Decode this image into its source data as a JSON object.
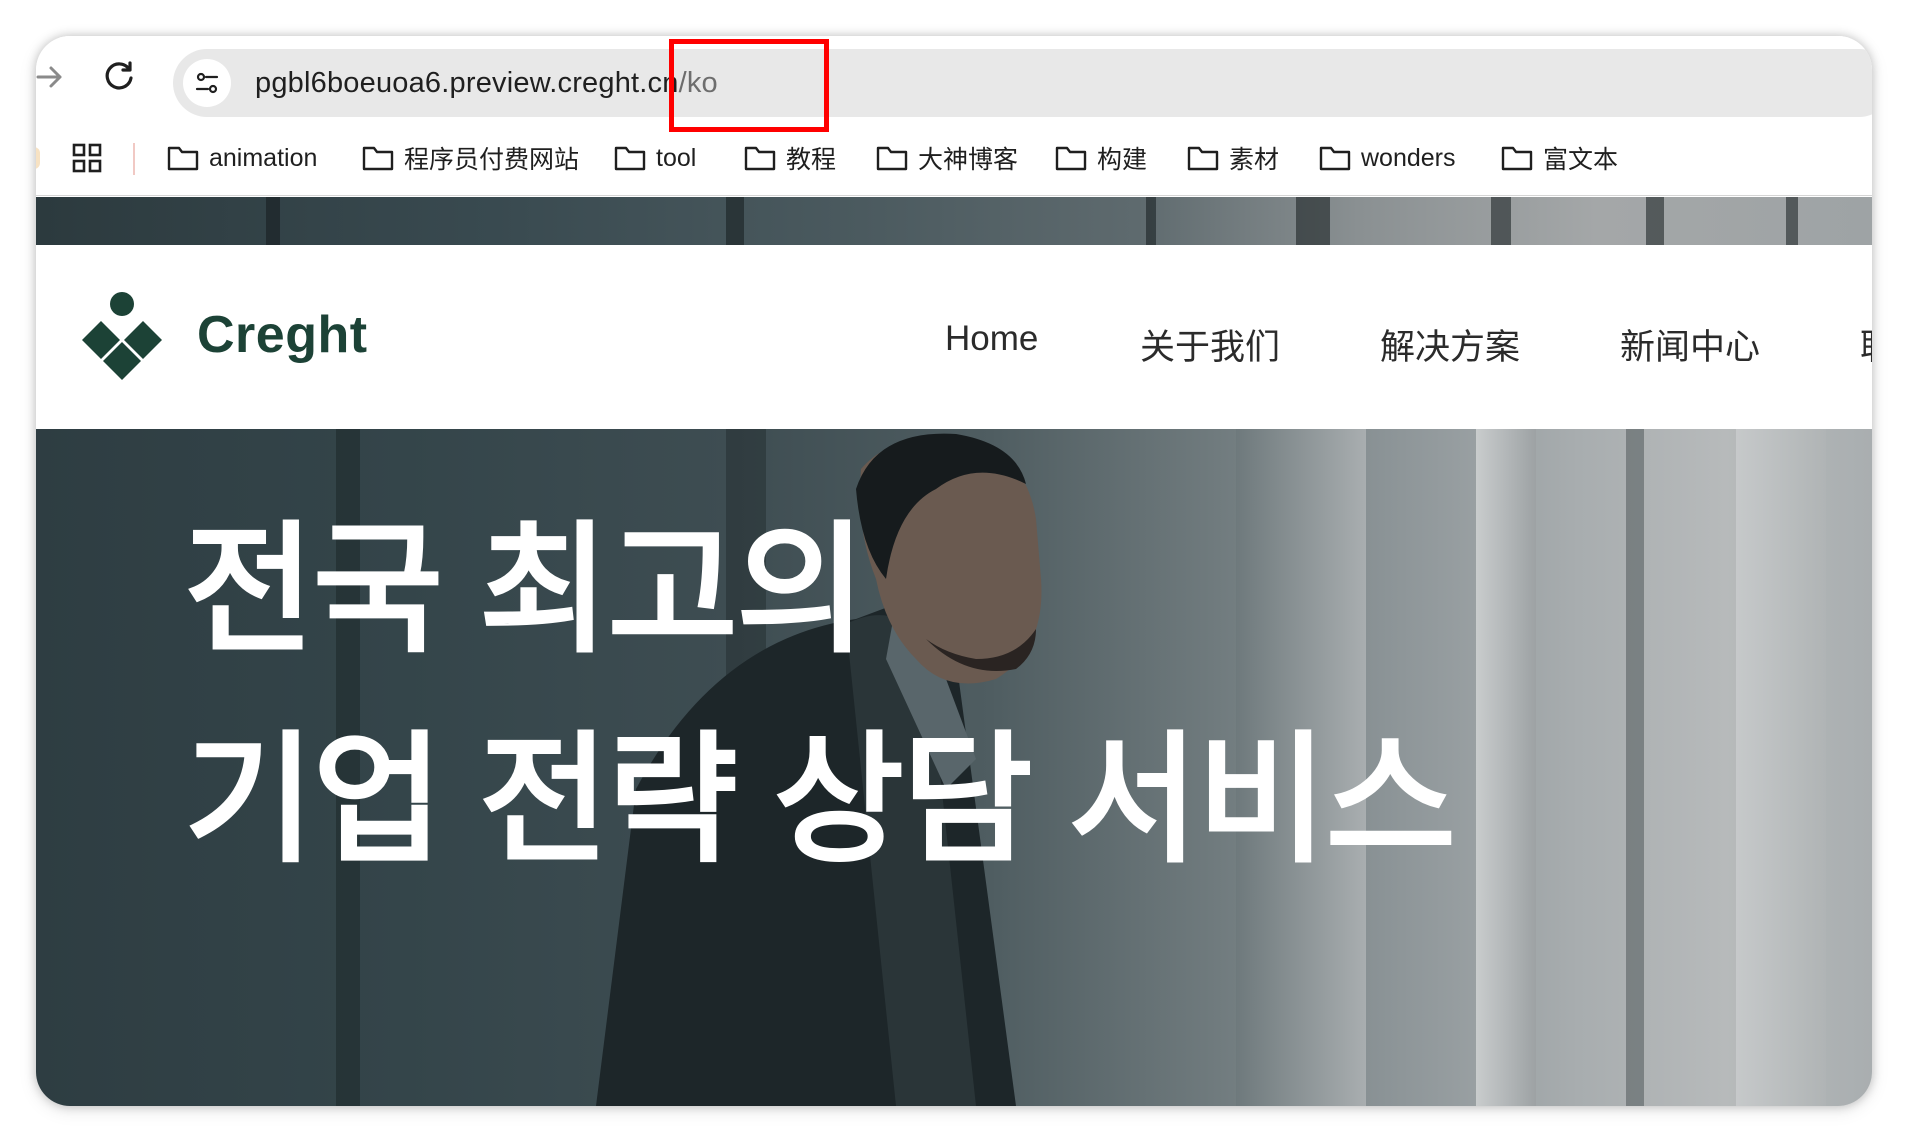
{
  "browser": {
    "url_host": "pgbl6boeuoa6.preview.creght.cn",
    "url_path": "/ko"
  },
  "bookmarks": [
    {
      "label": "animation"
    },
    {
      "label": "程序员付费网站"
    },
    {
      "label": "tool"
    },
    {
      "label": "教程"
    },
    {
      "label": "大神博客"
    },
    {
      "label": "构建"
    },
    {
      "label": "素材"
    },
    {
      "label": "wonders"
    },
    {
      "label": "富文本"
    }
  ],
  "site": {
    "logo_text": "Creght",
    "nav": [
      "Home",
      "关于我们",
      "解决方案",
      "新闻中心",
      "联"
    ]
  },
  "hero": {
    "title_line1": "전국 최고의",
    "title_line2": "기업 전략 상담 서비스"
  },
  "colors": {
    "brand_green": "#1c4236",
    "highlight_red": "#ff0000"
  },
  "icons": [
    "forward-icon",
    "reload-icon",
    "site-info-icon",
    "apps-grid-icon",
    "folder-icon"
  ]
}
